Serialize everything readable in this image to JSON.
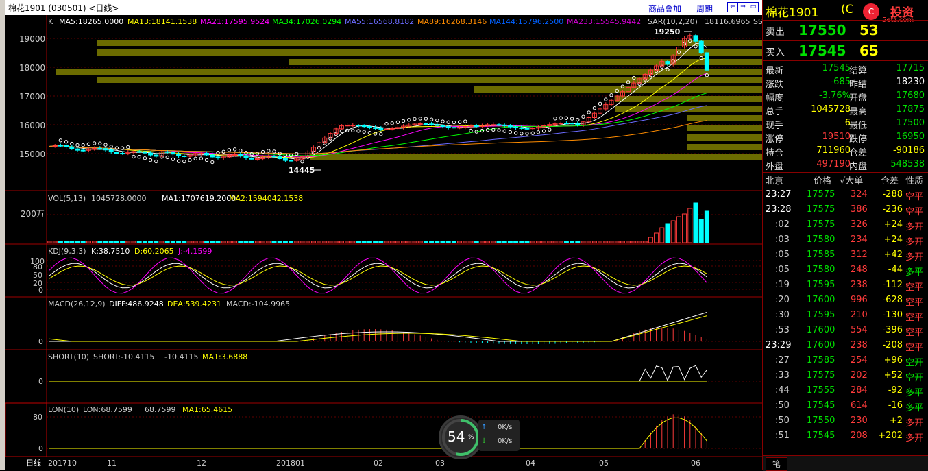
{
  "title": "棉花1901 (030501) <日线>",
  "toolbar": {
    "overlay": "商品叠加",
    "period": "周期"
  },
  "main_indicators": {
    "k": "K",
    "ma5": "MA5:18265.0000",
    "ma13": "MA13:18141.1538",
    "ma21": "MA21:17595.9524",
    "ma34": "MA34:17026.0294",
    "ma55": "MA55:16568.8182",
    "ma89": "MA89:16268.3146",
    "ma144": "MA144:15796.2500",
    "ma233": "MA233:15545.9442",
    "sar": "SAR(10,2,20)",
    "sar_val": "18116.6965",
    "ss": "SS"
  },
  "price_axis": [
    "19000",
    "18000",
    "17000",
    "16000",
    "15000"
  ],
  "price_high_label": "19250",
  "price_low_label": "14445",
  "vol": {
    "name": "VOL(5,13)",
    "val": "1045728.0000",
    "ma1": "MA1:1707619.2000",
    "ma2": "MA2:1594042.1538",
    "axis": "200万"
  },
  "kdj": {
    "name": "KDJ(9,3,3)",
    "k": "K:38.7510",
    "d": "D:60.2065",
    "j": "J:-4.1599",
    "axis": [
      "100",
      "80",
      "50",
      "20",
      "0"
    ]
  },
  "macd": {
    "name": "MACD(26,12,9)",
    "diff": "DIFF:486.9248",
    "dea": "DEA:539.4231",
    "macd": "MACD:-104.9965",
    "axis": "0"
  },
  "short": {
    "name": "SHORT(10)",
    "label": "SHORT:-10.4115",
    "val": "-10.4115",
    "ma1": "MA1:3.6888",
    "axis": "0"
  },
  "lon": {
    "name": "LON(10)",
    "label": "LON:68.7599",
    "val": "68.7599",
    "ma1": "MA1:65.4615",
    "axis": [
      "80",
      "0"
    ]
  },
  "x_axis": [
    {
      "label": "日线"
    },
    {
      "label": "201710"
    },
    {
      "label": "11"
    },
    {
      "label": "12"
    },
    {
      "label": "201801"
    },
    {
      "label": "02"
    },
    {
      "label": "03"
    },
    {
      "label": "04"
    },
    {
      "label": "05"
    },
    {
      "label": "06"
    }
  ],
  "loading": {
    "percent": "54",
    "unit": "%",
    "up_speed": "0K/s",
    "down_speed": "0K/s"
  },
  "quote": {
    "name": "棉花1901",
    "name_suffix": "(C",
    "brand": "投资",
    "brand_site": "5etz.com",
    "ask_label": "卖出",
    "ask_price": "17550",
    "ask_vol": "53",
    "bid_label": "买入",
    "bid_price": "17545",
    "bid_vol": "65",
    "rows": [
      {
        "l1": "最新",
        "v1": "17545",
        "c1": "green",
        "l2": "结算",
        "v2": "17715",
        "c2": "green"
      },
      {
        "l1": "涨跌",
        "v1": "-685",
        "c1": "green",
        "l2": "昨结",
        "v2": "18230",
        "c2": "white"
      },
      {
        "l1": "幅度",
        "v1": "-3.76%",
        "c1": "green",
        "l2": "开盘",
        "v2": "17680",
        "c2": "green"
      },
      {
        "l1": "总手",
        "v1": "1045728",
        "c1": "yellow",
        "l2": "最高",
        "v2": "17875",
        "c2": "green"
      },
      {
        "l1": "现手",
        "v1": "6",
        "c1": "yellow",
        "l2": "最低",
        "v2": "17500",
        "c2": "green"
      },
      {
        "l1": "涨停",
        "v1": "19510",
        "c1": "red",
        "l2": "跌停",
        "v2": "16950",
        "c2": "green"
      },
      {
        "l1": "持仓",
        "v1": "711960",
        "c1": "yellow",
        "l2": "仓差",
        "v2": "-90186",
        "c2": "yellow"
      },
      {
        "l1": "外盘",
        "v1": "497190",
        "c1": "red",
        "l2": "内盘",
        "v2": "548538",
        "c2": "green"
      }
    ],
    "tick_header": {
      "time": "北京",
      "price": "价格",
      "big": "√大单",
      "oi": "仓差",
      "nature": "性质"
    },
    "ticks": [
      {
        "t": "23:27",
        "p": "17575",
        "v": "324",
        "oi": "-288",
        "n": "空平",
        "pc": "green",
        "nc": "red",
        "tw": true
      },
      {
        "t": "23:28",
        "p": "17575",
        "v": "386",
        "oi": "-236",
        "n": "空平",
        "pc": "green",
        "nc": "red",
        "tw": true
      },
      {
        "t": ":02",
        "p": "17575",
        "v": "326",
        "oi": "+24",
        "n": "多开",
        "pc": "green",
        "nc": "red",
        "tw": false
      },
      {
        "t": ":03",
        "p": "17580",
        "v": "234",
        "oi": "+24",
        "n": "多开",
        "pc": "green",
        "nc": "red",
        "tw": false
      },
      {
        "t": ":05",
        "p": "17585",
        "v": "312",
        "oi": "+42",
        "n": "多开",
        "pc": "green",
        "nc": "red",
        "tw": false
      },
      {
        "t": ":05",
        "p": "17580",
        "v": "248",
        "oi": "-44",
        "n": "多平",
        "pc": "green",
        "nc": "green",
        "tw": false
      },
      {
        "t": ":19",
        "p": "17595",
        "v": "238",
        "oi": "-112",
        "n": "空平",
        "pc": "green",
        "nc": "red",
        "tw": false
      },
      {
        "t": ":20",
        "p": "17600",
        "v": "996",
        "oi": "-628",
        "n": "空平",
        "pc": "green",
        "nc": "red",
        "tw": false
      },
      {
        "t": ":30",
        "p": "17595",
        "v": "210",
        "oi": "-130",
        "n": "空平",
        "pc": "green",
        "nc": "red",
        "tw": false
      },
      {
        "t": ":53",
        "p": "17600",
        "v": "554",
        "oi": "-396",
        "n": "空平",
        "pc": "green",
        "nc": "red",
        "tw": false
      },
      {
        "t": "23:29",
        "p": "17600",
        "v": "238",
        "oi": "-208",
        "n": "空平",
        "pc": "green",
        "nc": "red",
        "tw": true
      },
      {
        "t": ":27",
        "p": "17585",
        "v": "254",
        "oi": "+96",
        "n": "空开",
        "pc": "green",
        "nc": "green",
        "tw": false
      },
      {
        "t": ":33",
        "p": "17575",
        "v": "202",
        "oi": "+52",
        "n": "空开",
        "pc": "green",
        "nc": "green",
        "tw": false
      },
      {
        "t": ":44",
        "p": "17555",
        "v": "284",
        "oi": "-92",
        "n": "多平",
        "pc": "green",
        "nc": "green",
        "tw": false
      },
      {
        "t": ":50",
        "p": "17545",
        "v": "614",
        "oi": "-16",
        "n": "多平",
        "pc": "green",
        "nc": "green",
        "tw": false
      },
      {
        "t": ":50",
        "p": "17550",
        "v": "230",
        "oi": "+2",
        "n": "多开",
        "pc": "green",
        "nc": "red",
        "tw": false
      },
      {
        "t": ":51",
        "p": "17545",
        "v": "208",
        "oi": "+202",
        "n": "多开",
        "pc": "green",
        "nc": "red",
        "tw": false
      }
    ],
    "bottom_tab": "笔"
  },
  "colors": {
    "ma5": "#ffffff",
    "ma13": "#ffff00",
    "ma21": "#ff00ff",
    "ma34": "#00ff00",
    "ma55": "#6b6bff",
    "ma89": "#ff8c00",
    "ma144": "#0060ff",
    "ma233": "#d000d0",
    "up": "#ff3b3b",
    "down": "#00ffff",
    "grid": "#800000",
    "volume_profile": "#6b6b00"
  }
}
